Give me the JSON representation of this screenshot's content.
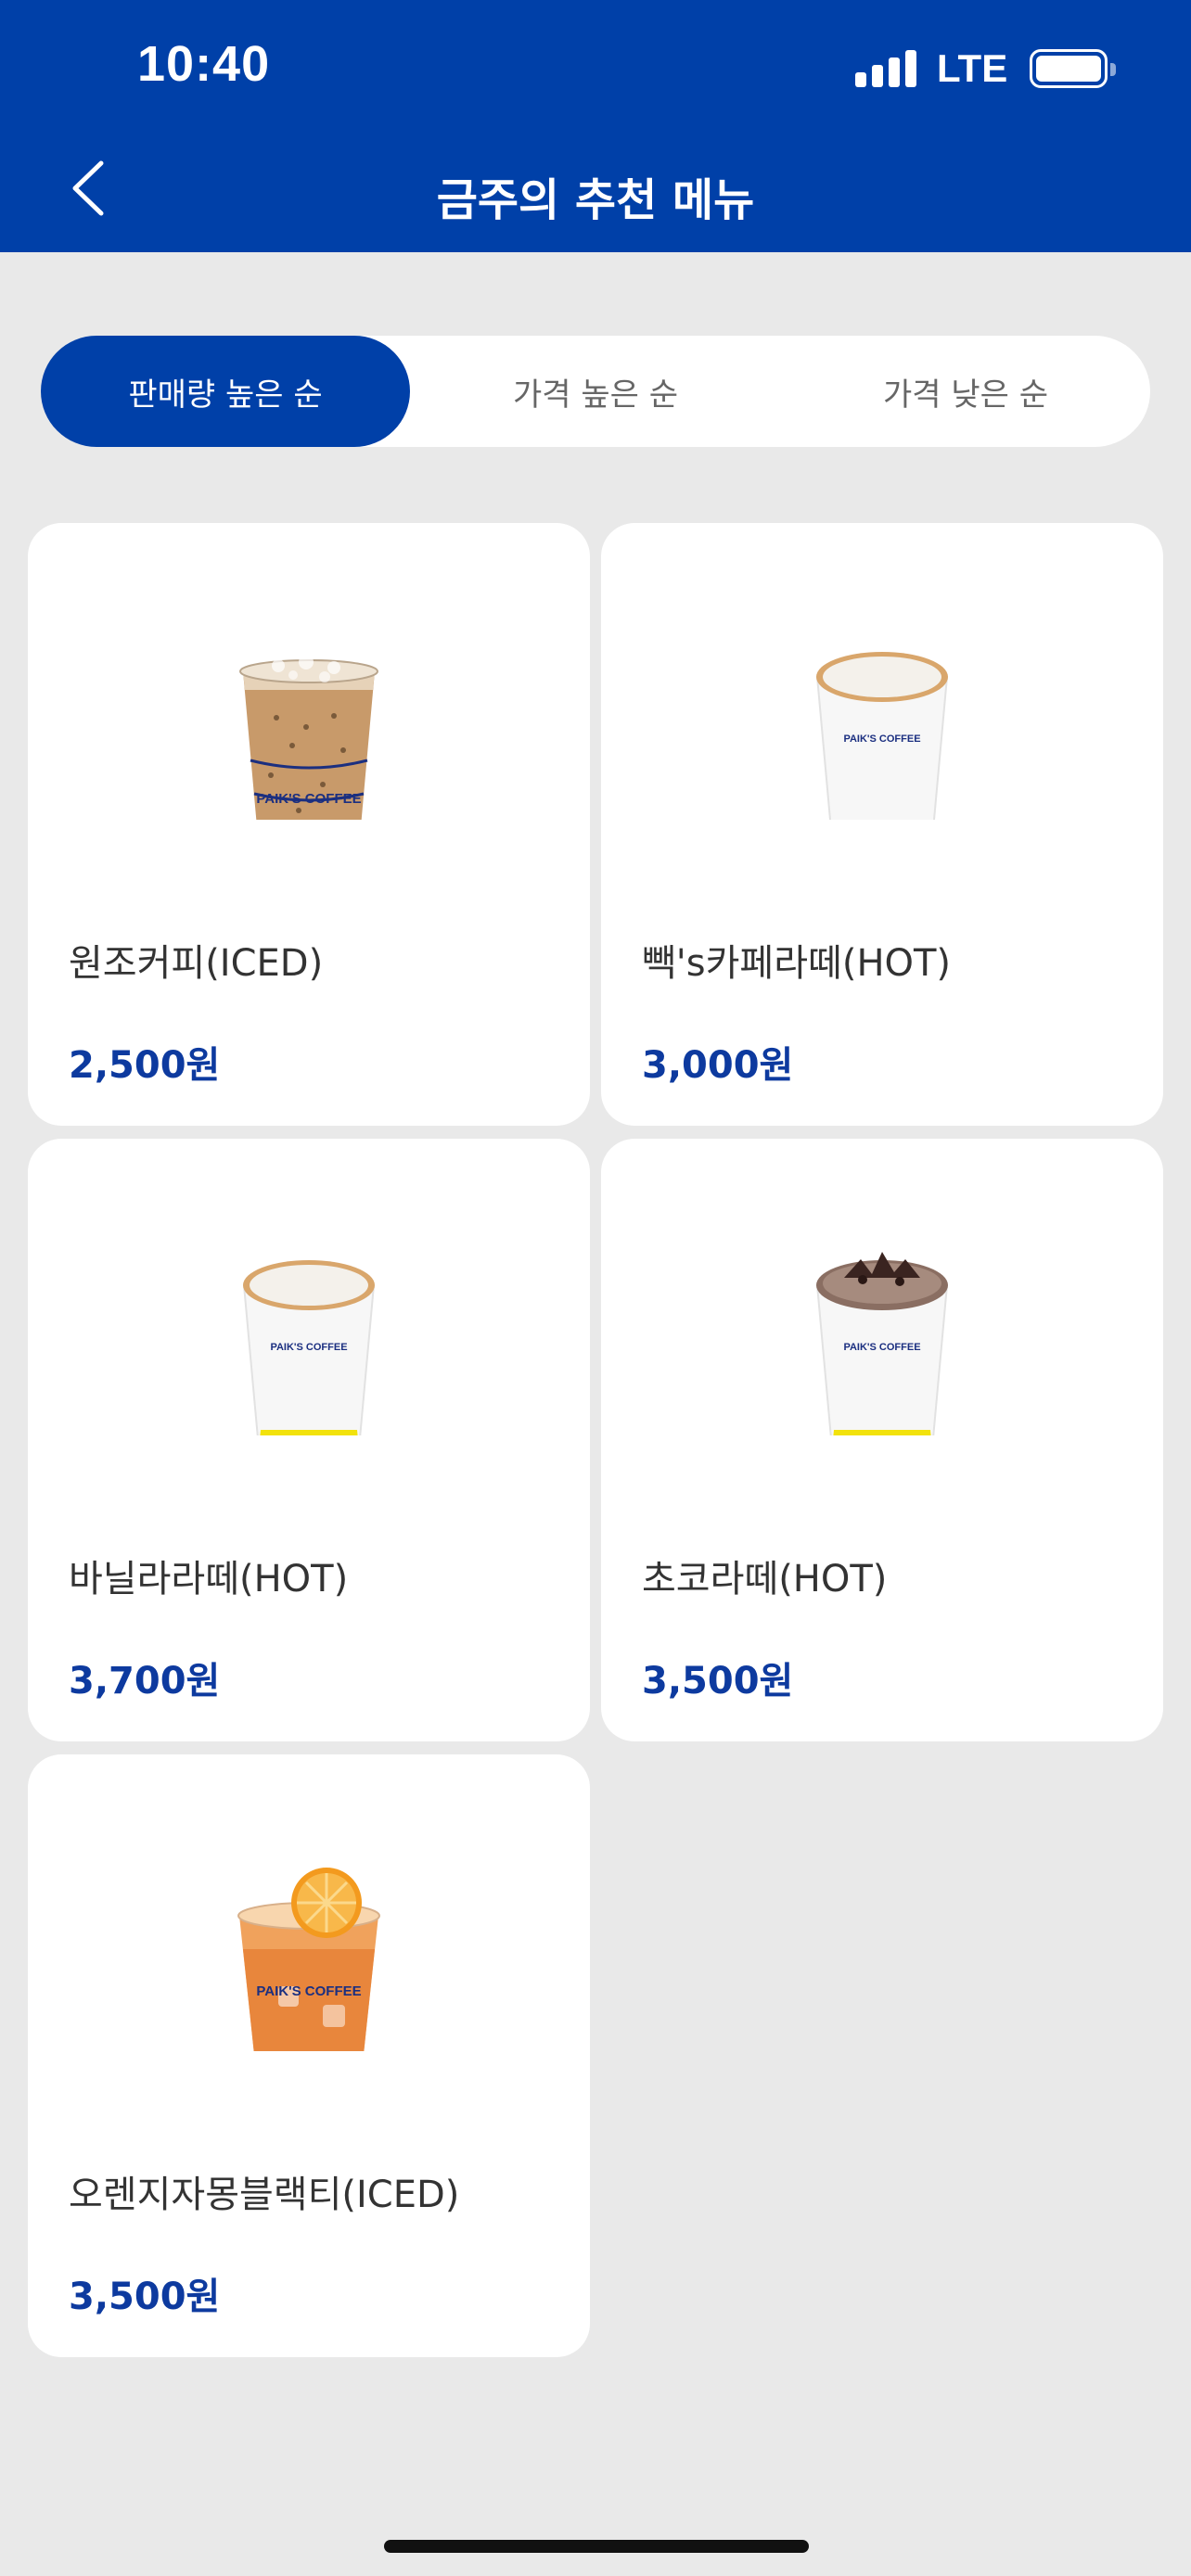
{
  "status": {
    "time": "10:40",
    "network": "LTE"
  },
  "header": {
    "title": "금주의 추천 메뉴",
    "back_icon": "chevron-left-icon"
  },
  "sort_tabs": [
    {
      "label": "판매량 높은 순",
      "active": true
    },
    {
      "label": "가격 높은 순",
      "active": false
    },
    {
      "label": "가격 낮은 순",
      "active": false
    }
  ],
  "products": [
    {
      "name": "원조커피(ICED)",
      "price": "2,500원",
      "image": "iced-coffee-cup"
    },
    {
      "name": "빽's카페라떼(HOT)",
      "price": "3,000원",
      "image": "hot-latte-cup"
    },
    {
      "name": "바닐라라떼(HOT)",
      "price": "3,700원",
      "image": "hot-latte-cup"
    },
    {
      "name": "초코라떼(HOT)",
      "price": "3,500원",
      "image": "hot-chocolate-cup"
    },
    {
      "name": "오렌지자몽블랙티(ICED)",
      "price": "3,500원",
      "image": "iced-orange-tea-cup"
    }
  ],
  "brand_print": "PAIK'S COFFEE",
  "colors": {
    "primary": "#0040a8",
    "price": "#0d3a9f",
    "background": "#e9e9e9",
    "cup_band": "#f2e20c"
  }
}
